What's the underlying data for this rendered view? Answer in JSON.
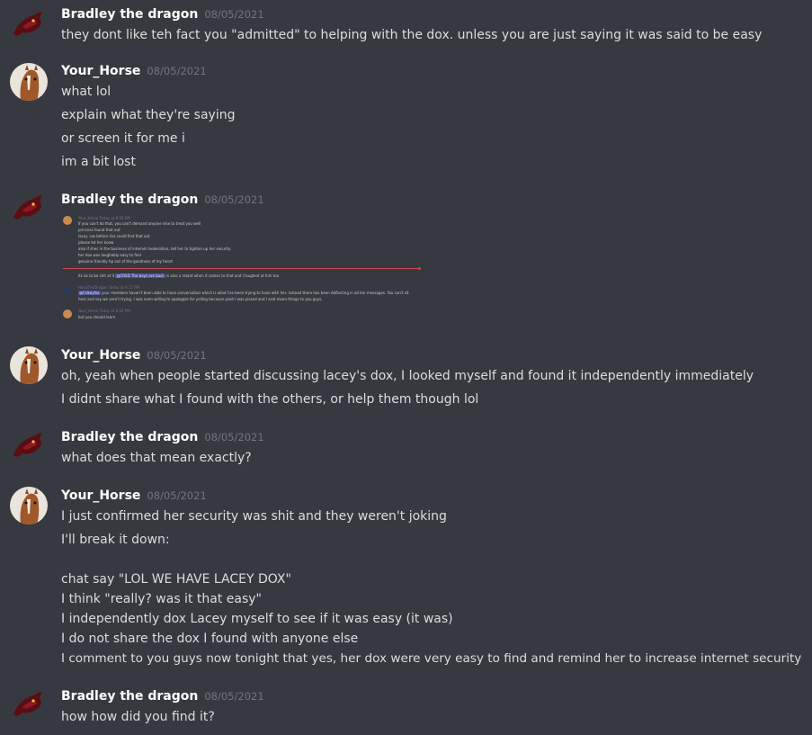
{
  "users": {
    "bradley": {
      "name": "Bradley the dragon",
      "avatar_icon": "dragon-avatar-icon"
    },
    "horse": {
      "name": "Your_Horse",
      "avatar_icon": "horse-avatar-icon"
    }
  },
  "messages": [
    {
      "author": "Bradley the dragon",
      "time": "08/05/2021",
      "lines": [
        "they dont like teh fact you \"admitted\" to helping with the dox. unless you are just saying it was said to be easy"
      ]
    },
    {
      "author": "Your_Horse",
      "time": "08/05/2021",
      "lines": [
        "what lol",
        "explain what they're saying",
        "or screen it for me i",
        "im a bit lost"
      ]
    },
    {
      "author": "Bradley the dragon",
      "time": "08/05/2021",
      "lines": []
    },
    {
      "author": "Your_Horse",
      "time": "08/05/2021",
      "lines": [
        "oh, yeah when people started discussing lacey's dox, I looked myself and found it independently immediately",
        "I didnt share what I found with the others, or help them though lol"
      ]
    },
    {
      "author": "Bradley the dragon",
      "time": "08/05/2021",
      "lines": [
        "what does that mean exactly?"
      ]
    },
    {
      "author": "Your_Horse",
      "time": "08/05/2021",
      "lines": [
        "I just confirmed her security was shit and they weren't joking",
        "I'll break it down:",
        "chat say \"LOL WE HAVE LACEY DOX\"",
        "I think \"really? was it that easy\"",
        "I independently dox Lacey myself to see if it was easy (it was)",
        "I do not share the dox I found with anyone else",
        "I comment to you guys now tonight that yes, her dox were very easy to find and remind her to increase internet security"
      ]
    },
    {
      "author": "Bradley the dragon",
      "time": "08/05/2021",
      "lines": [
        "how how did you find it?"
      ]
    }
  ],
  "embedded_screenshot": {
    "msg1": {
      "author": "Your_Horse",
      "time": "Today at 9:05 PM",
      "lines": [
        "If you can't do that, you can't demand anyone else to treat you well",
        "princess found that out",
        "lacey :ow before she could find that out",
        "please let her know",
        "also if shes in the business of internet moderation, tell her to tighten up her security",
        "her dox was laughably easy to find",
        "genuine friendly tip out of the goodness of my heart",
        "its ok to be shit at it",
        "The boys are back",
        "is also a retard when it comes to that and I laughed at him too"
      ],
      "mention1": "@CRSD",
      "mention2": "@CRSD"
    },
    "msg2": {
      "author": "HandTheDragon",
      "time": "Today at 9:17 PM",
      "lines": [
        "your members haven't been able to have conversation which is what I've been trying to have with her. instead there has been deflecting in all her messages. You can't sit",
        "here and say we aren't trying. I was even willing to apologize for yelling because yeah I was pissed and I said mean things to you guys."
      ],
      "mention": "@Crikeyfox"
    },
    "msg3": {
      "author": "Your_Horse",
      "time": "Today at 9:22 PM",
      "lines": [
        "but you should learn"
      ]
    }
  },
  "colors": {
    "background": "#36393f",
    "text": "#dcddde",
    "username": "#ffffff",
    "timestamp": "#72767d",
    "mention_bg": "#4a5196",
    "divider_red": "#c94f4f"
  }
}
